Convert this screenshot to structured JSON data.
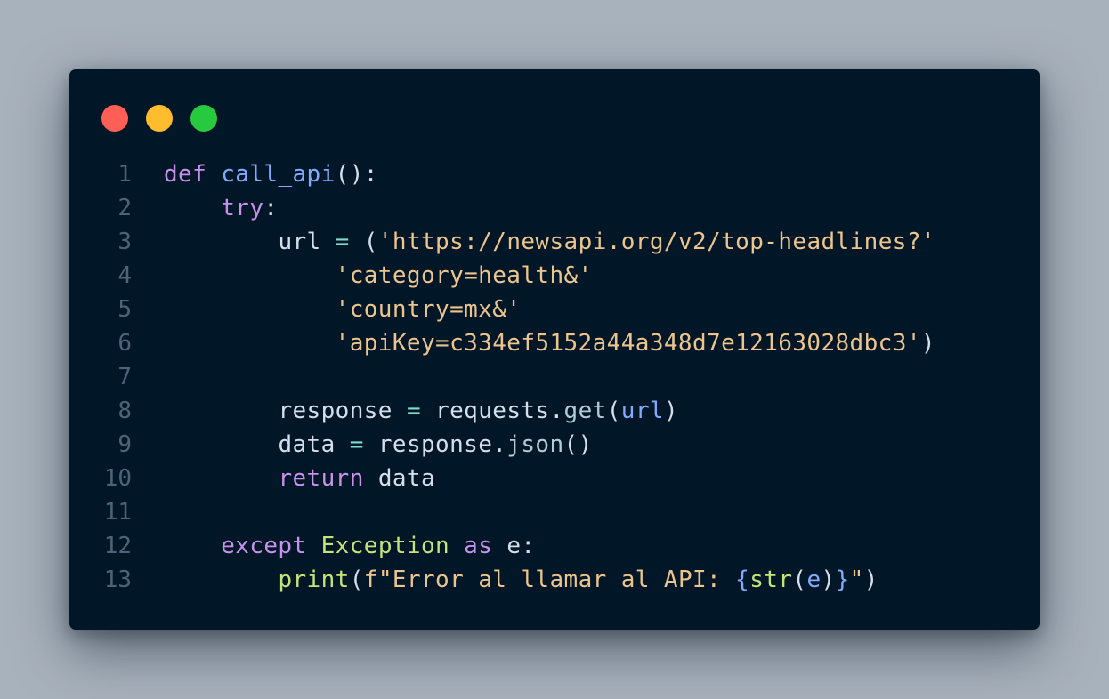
{
  "window": {
    "controls": {
      "close": "close-dot",
      "minimize": "minimize-dot",
      "maximize": "maximize-dot"
    }
  },
  "code": {
    "language": "python",
    "lines": [
      {
        "n": "1",
        "tokens": {
          "a": "def",
          "b": " ",
          "c": "call_api",
          "d": "():"
        }
      },
      {
        "n": "2",
        "tokens": {
          "i": "    ",
          "a": "try",
          "b": ":"
        }
      },
      {
        "n": "3",
        "tokens": {
          "i": "        ",
          "a": "url",
          "b": " ",
          "c": "=",
          "d": " (",
          "e": "'https://newsapi.org/v2/top-headlines?'"
        }
      },
      {
        "n": "4",
        "tokens": {
          "i": "            ",
          "a": "'category=health&'"
        }
      },
      {
        "n": "5",
        "tokens": {
          "i": "            ",
          "a": "'country=mx&'"
        }
      },
      {
        "n": "6",
        "tokens": {
          "i": "            ",
          "a": "'apiKey=c334ef5152a44a348d7e12163028dbc3'",
          "b": ")"
        }
      },
      {
        "n": "7",
        "tokens": {}
      },
      {
        "n": "8",
        "tokens": {
          "i": "        ",
          "a": "response",
          "b": " ",
          "c": "=",
          "d": " requests.",
          "e": "get",
          "f": "(",
          "g": "url",
          "h": ")"
        }
      },
      {
        "n": "9",
        "tokens": {
          "i": "        ",
          "a": "data",
          "b": " ",
          "c": "=",
          "d": " response.",
          "e": "json",
          "f": "()"
        }
      },
      {
        "n": "10",
        "tokens": {
          "i": "        ",
          "a": "return",
          "b": " data"
        }
      },
      {
        "n": "11",
        "tokens": {}
      },
      {
        "n": "12",
        "tokens": {
          "i": "    ",
          "a": "except",
          "b": " ",
          "c": "Exception",
          "d": " ",
          "e": "as",
          "f": " e:"
        }
      },
      {
        "n": "13",
        "tokens": {
          "i": "        ",
          "a": "print",
          "b": "(",
          "c": "f\"Error al llamar al API: ",
          "d": "{",
          "e": "str",
          "f": "(",
          "g": "e",
          "h": ")",
          "j": "}",
          "k": "\"",
          "l": ")"
        }
      }
    ]
  }
}
